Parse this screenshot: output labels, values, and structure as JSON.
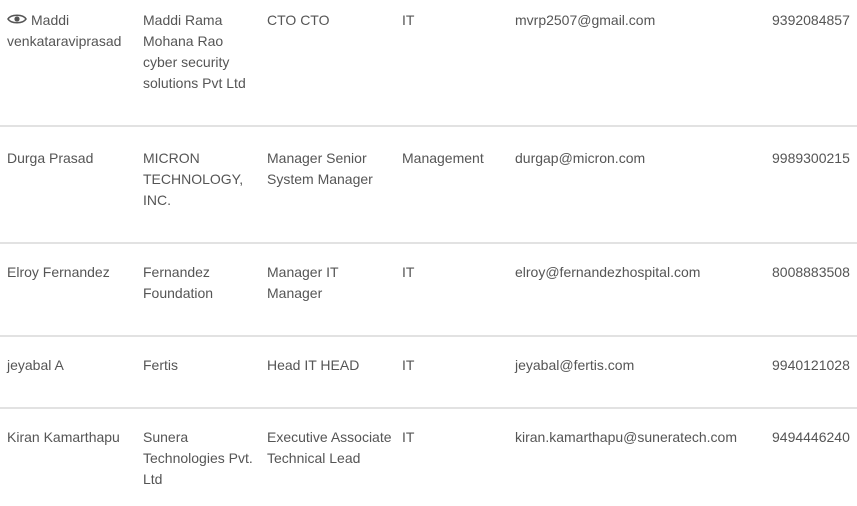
{
  "contacts": [
    {
      "name": "Maddi venkataraviprasad",
      "company": "Maddi Rama Mohana Rao cyber security solutions Pvt Ltd",
      "title": "CTO CTO",
      "department": "IT",
      "email": "mvrp2507@gmail.com",
      "phone": "9392084857",
      "icon": "eye-icon"
    },
    {
      "name": "Durga Prasad",
      "company": "MICRON TECHNOLOGY, INC.",
      "title": "Manager Senior System Manager",
      "department": "Management",
      "email": "durgap@micron.com",
      "phone": "9989300215"
    },
    {
      "name": "Elroy Fernandez",
      "company": "Fernandez Foundation",
      "title": "Manager IT Manager",
      "department": "IT",
      "email": "elroy@fernandezhospital.com",
      "phone": "8008883508"
    },
    {
      "name": "jeyabal A",
      "company": "Fertis",
      "title": "Head IT HEAD",
      "department": "IT",
      "email": "jeyabal@fertis.com",
      "phone": "9940121028"
    },
    {
      "name": "Kiran Kamarthapu",
      "company": "Sunera Technologies Pvt. Ltd",
      "title": "Executive Associate Technical Lead",
      "department": "IT",
      "email": "kiran.kamarthapu@suneratech.com",
      "phone": "9494446240"
    }
  ],
  "colors": {
    "text": "#555555",
    "divider": "#e2e2e2"
  }
}
